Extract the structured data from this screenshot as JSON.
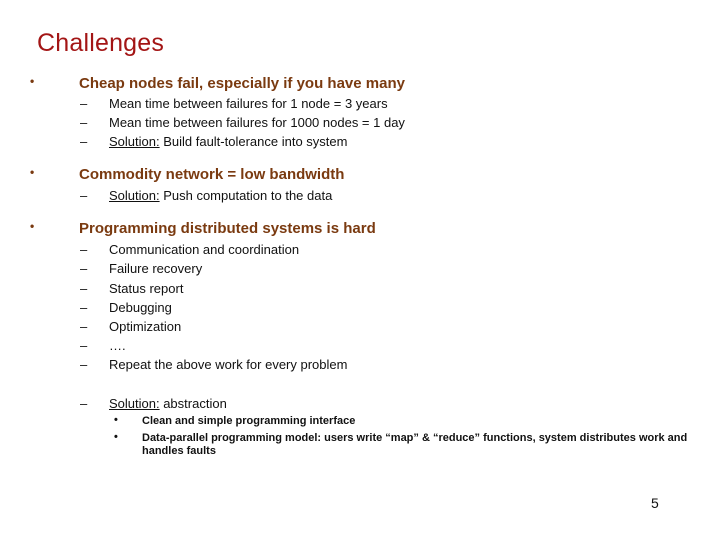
{
  "slide": {
    "title": "Challenges",
    "page_number": "5",
    "colors": {
      "title": "#a31515",
      "level1": "#7a3a10"
    },
    "bullet_glyph": "•",
    "dash_glyph": "–",
    "sections": [
      {
        "heading": "Cheap nodes fail, especially if you have many",
        "items": [
          {
            "prefix": "",
            "text": "Mean time between failures for 1 node = 3 years"
          },
          {
            "prefix": "",
            "text": "Mean time between failures for 1000 nodes = 1 day"
          },
          {
            "prefix": "Solution:",
            "text": " Build fault-tolerance into system"
          }
        ]
      },
      {
        "heading": "Commodity network = low bandwidth",
        "items": [
          {
            "prefix": "Solution:",
            "text": " Push computation to the data"
          }
        ]
      },
      {
        "heading": "Programming distributed systems is hard",
        "items": [
          {
            "prefix": "",
            "text": "Communication and coordination"
          },
          {
            "prefix": "",
            "text": "Failure recovery"
          },
          {
            "prefix": "",
            "text": "Status report"
          },
          {
            "prefix": "",
            "text": "Debugging"
          },
          {
            "prefix": "",
            "text": "Optimization"
          },
          {
            "prefix": "",
            "text": "…."
          },
          {
            "prefix": "",
            "text": "Repeat the above work for every problem"
          },
          {
            "prefix": "Solution:",
            "text": " abstraction"
          }
        ],
        "subitems": [
          "Clean and simple programming interface",
          "Data-parallel programming model: users write “map” & “reduce” functions, system distributes work and handles faults"
        ]
      }
    ]
  }
}
